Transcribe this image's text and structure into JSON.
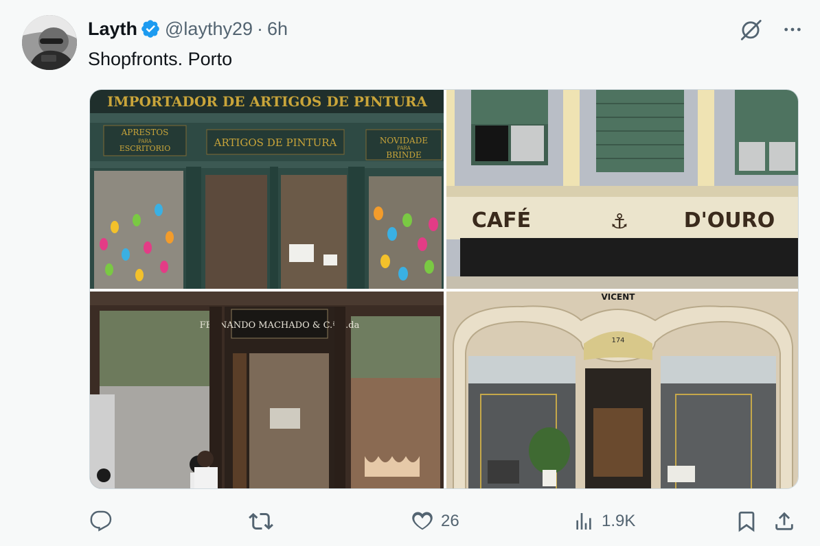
{
  "tweet": {
    "author_name": "Layth",
    "handle": "@laythy29",
    "separator": "·",
    "time": "6h",
    "text": "Shopfronts. Porto"
  },
  "media": {
    "photo1": {
      "sign_main": "IMPORTADOR DE ARTIGOS DE PINTURA",
      "sign_left_1": "APRESTOS",
      "sign_left_2": "PARA",
      "sign_left_3": "ESCRITORIO",
      "sign_center": "ARTIGOS DE PINTURA",
      "sign_right_1": "NOVIDADE",
      "sign_right_2": "PARA",
      "sign_right_3": "BRINDE"
    },
    "photo2": {
      "sign": "CAFÉ",
      "sign_right": "D'OURO"
    },
    "photo3": {
      "sign": "FERNANDO MACHADO & C.ª L.da"
    },
    "photo4": {
      "sign_top": "VICENT",
      "number": "174"
    }
  },
  "actions": {
    "replies": "",
    "retweets": "",
    "likes": "26",
    "views": "1.9K"
  },
  "colors": {
    "verified": "#1d9bf0",
    "text_secondary": "#536471",
    "background": "#f7f9f9"
  },
  "icons": [
    "grok-icon",
    "more-icon",
    "reply-icon",
    "retweet-icon",
    "like-icon",
    "views-icon",
    "bookmark-icon",
    "share-icon",
    "verified-badge-icon"
  ]
}
